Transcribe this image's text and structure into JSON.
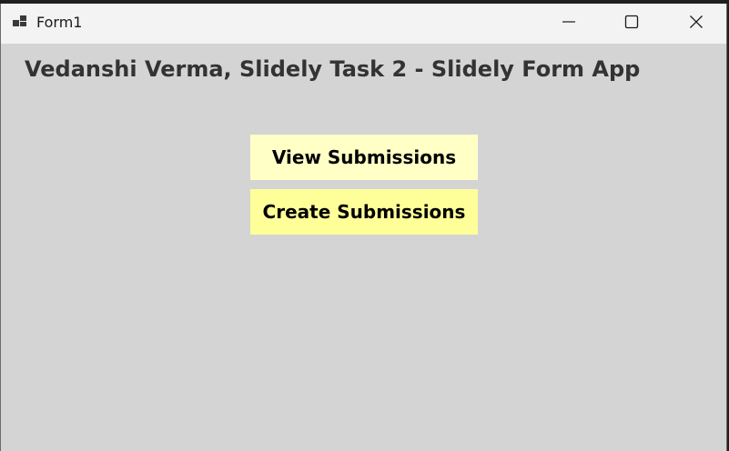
{
  "window": {
    "title": "Form1",
    "caption_buttons": {
      "minimize_icon": "minimize-icon",
      "maximize_icon": "maximize-icon",
      "close_icon": "close-icon"
    }
  },
  "form": {
    "heading": "Vedanshi Verma, Slidely Task 2 - Slidely Form App",
    "buttons": {
      "view_label": "View Submissions",
      "create_label": "Create Submissions"
    }
  },
  "colors": {
    "form_background": "#d4d4d4",
    "titlebar_background": "#f3f3f3",
    "view_button": "#ffffc6",
    "create_button": "#ffff99"
  }
}
